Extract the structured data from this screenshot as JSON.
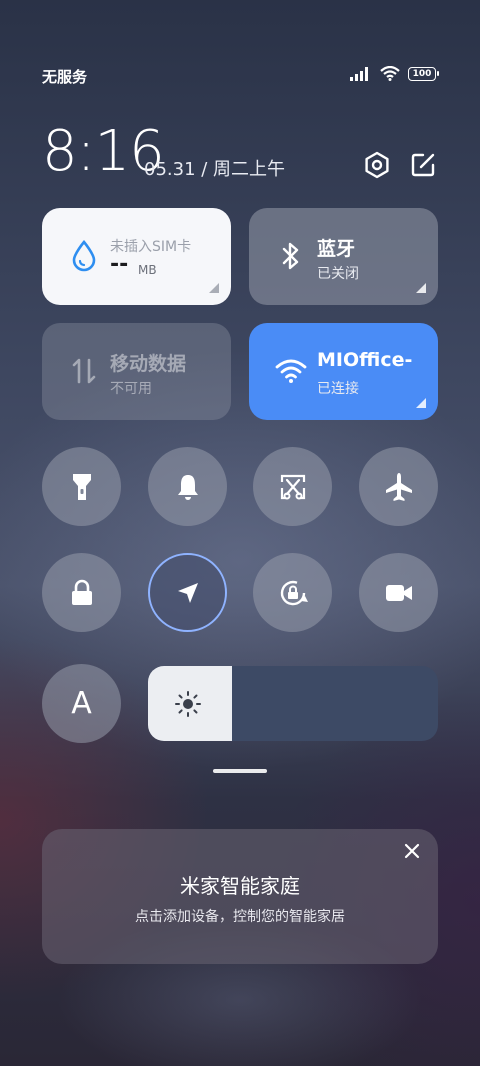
{
  "status_bar": {
    "carrier": "无服务",
    "battery": "100",
    "icons": [
      "signal-icon",
      "wifi-icon",
      "battery-icon"
    ]
  },
  "header": {
    "time": "8:16",
    "date": "05.31 / 周二上午",
    "icons": [
      "settings-icon",
      "edit-icon"
    ]
  },
  "tiles": {
    "data_usage": {
      "title": "未插入SIM卡",
      "value": "--",
      "unit": "MB",
      "icon": "water-drop-icon"
    },
    "bluetooth": {
      "title": "蓝牙",
      "status": "已关闭",
      "icon": "bluetooth-icon"
    },
    "mobile_data": {
      "title": "移动数据",
      "status": "不可用",
      "icon": "data-arrows-icon"
    },
    "wifi": {
      "title": "MIOffice-",
      "status": "已连接",
      "icon": "wifi-icon"
    }
  },
  "toggles": [
    {
      "name": "flashlight",
      "icon": "flashlight-icon"
    },
    {
      "name": "ring",
      "icon": "bell-icon"
    },
    {
      "name": "screenshot",
      "icon": "scissors-screenshot-icon"
    },
    {
      "name": "airplane",
      "icon": "airplane-icon"
    },
    {
      "name": "lock",
      "icon": "lock-icon"
    },
    {
      "name": "location",
      "icon": "location-arrow-icon",
      "active": true
    },
    {
      "name": "rotation-lock",
      "icon": "rotation-lock-icon"
    },
    {
      "name": "screen-record",
      "icon": "video-camera-icon"
    }
  ],
  "font_button": {
    "label": "A"
  },
  "brightness": {
    "level": 0.29,
    "icon": "sun-icon"
  },
  "mi_home_card": {
    "title": "米家智能家庭",
    "subtitle": "点击添加设备，控制您的智能家居",
    "close_icon": "close-icon"
  },
  "colors": {
    "accent_blue": "#4a8cf6",
    "tile_light": "#f6f7fa",
    "drop_blue": "#2e8ef0"
  }
}
